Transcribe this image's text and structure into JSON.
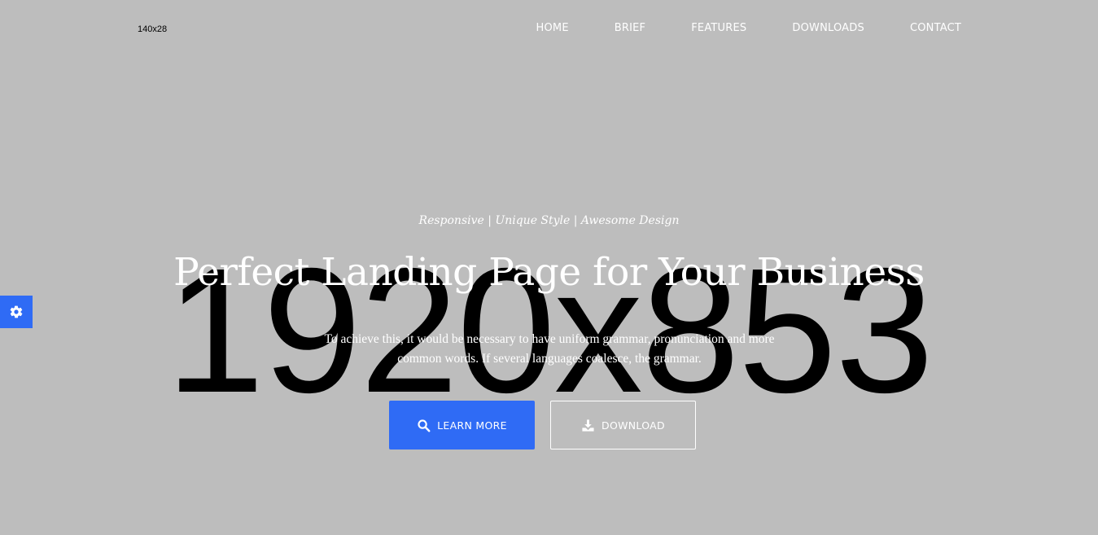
{
  "placeholder": {
    "background_label": "1920x853",
    "logo_label": "140x28"
  },
  "nav": {
    "items": [
      {
        "label": "HOME"
      },
      {
        "label": "BRIEF"
      },
      {
        "label": "FEATURES"
      },
      {
        "label": "DOWNLOADS"
      },
      {
        "label": "CONTACT"
      }
    ]
  },
  "settings": {
    "icon": "gear-icon"
  },
  "hero": {
    "tagline": "Responsive | Unique Style | Awesome Design",
    "headline": "Perfect Landing Page for Your Business",
    "subtext": "To achieve this, it would be necessary to have uniform grammar, pronunciation and more common words. If several languages coalesce, the grammar.",
    "learn_more_label": "LEARN MORE",
    "learn_more_icon": "search-icon",
    "download_label": "DOWNLOAD",
    "download_icon": "download-icon"
  },
  "colors": {
    "background": "#bdbdbd",
    "accent": "#2f6bf5",
    "text": "#ffffff"
  }
}
